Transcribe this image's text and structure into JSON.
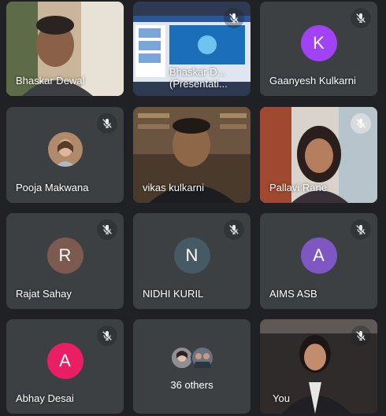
{
  "colors": {
    "background": "#202124",
    "tile": "#3c4043",
    "avatar_k": "#a142f4",
    "avatar_r": "#7d5a50",
    "avatar_n": "#455a64",
    "avatar_a1": "#7e57c2",
    "avatar_a2": "#e91e63"
  },
  "tiles": {
    "bhaskar": {
      "name": "Bhaskar Dewal"
    },
    "presentation": {
      "name_line1": "Bhaskar D...",
      "name_line2": "(Presentati..."
    },
    "gaanyesh": {
      "name": "Gaanyesh Kulkarni",
      "initial": "K"
    },
    "pooja": {
      "name": "Pooja Makwana"
    },
    "vikas": {
      "name": "vikas kulkarni"
    },
    "pallavi": {
      "name": "Pallavi Rane"
    },
    "rajat": {
      "name": "Rajat Sahay",
      "initial": "R"
    },
    "nidhi": {
      "name": "NIDHI KURIL",
      "initial": "N"
    },
    "aims": {
      "name": "AIMS ASB",
      "initial": "A"
    },
    "abhay": {
      "name": "Abhay Desai",
      "initial": "A"
    },
    "others": {
      "label": "36 others"
    },
    "you": {
      "name": "You"
    }
  },
  "icons": {
    "muted_mic": "mic-off-icon"
  }
}
